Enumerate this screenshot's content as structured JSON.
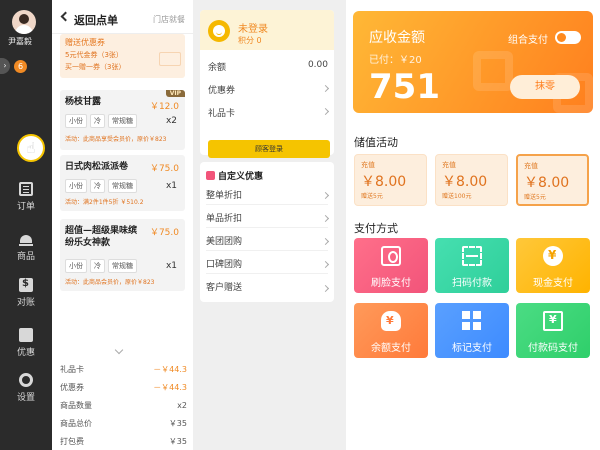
{
  "sidebar": {
    "user_name": "尹嘉毅",
    "badge_count": "6",
    "expand_glyph": "›",
    "active_icon": "hand-pointer-icon",
    "items": [
      {
        "label": "订单",
        "icon": "order-list-icon"
      },
      {
        "label": "商品",
        "icon": "goods-icon"
      },
      {
        "label": "对账",
        "icon": "bill-icon"
      },
      {
        "label": "优惠",
        "icon": "promotion-icon"
      },
      {
        "label": "设置",
        "icon": "settings-icon"
      }
    ]
  },
  "orders": {
    "back_label": "返回点单",
    "store_label": "门店就餐",
    "coupon": {
      "title": "赠送优惠券",
      "line1": "5元代金券（3张）",
      "line2": "买一赠一券（3张）"
    },
    "items": [
      {
        "name": "杨枝甘露",
        "price": "￥12.0",
        "tags": [
          "小份",
          "冷",
          "常规糖"
        ],
        "qty": "x2",
        "note": "活动：此商品享受会员价，原价￥823",
        "vip": "VIP"
      },
      {
        "name": "日式肉松派派卷",
        "price": "￥75.0",
        "tags": [
          "小份",
          "冷",
          "常规糖"
        ],
        "qty": "x1",
        "note": "活动：满2件1件5折 ￥510.2"
      },
      {
        "name": "超值—超级果味缤纷乐女神款",
        "price": "￥75.0",
        "tags": [
          "小份",
          "冷",
          "常规糖"
        ],
        "qty": "x1",
        "note": "活动：此商品会员价，原价￥823"
      }
    ],
    "summary": [
      {
        "label": "礼品卡",
        "value": "－￥44.3",
        "neg": true
      },
      {
        "label": "优惠券",
        "value": "－￥44.3",
        "neg": true
      },
      {
        "label": "商品数量",
        "value": "x2",
        "neg": false
      },
      {
        "label": "商品总价",
        "value": "￥35",
        "neg": false
      },
      {
        "label": "打包费",
        "value": "￥35",
        "neg": false
      }
    ]
  },
  "member": {
    "status": "未登录",
    "points": "积分 0",
    "balance_label": "余额",
    "balance_value": "0.00",
    "coupon_label": "优惠券",
    "gift_card_label": "礼品卡",
    "guest_login": "顾客登录"
  },
  "discounts": {
    "title": "自定义优惠",
    "options": [
      "整单折扣",
      "单品折扣",
      "美团团购",
      "口碑团购",
      "客户赠送"
    ]
  },
  "payment": {
    "due_label": "应收金额",
    "paid_label": "已付：￥20",
    "amount": "751",
    "combo_label": "组合支付",
    "erase_label": "抹零",
    "stored_title": "储值活动",
    "stored_cards": [
      {
        "top": "充值",
        "amount": "￥8.00",
        "bottom": "赠送5元",
        "selected": false
      },
      {
        "top": "充值",
        "amount": "￥8.00",
        "bottom": "赠送100元",
        "selected": false
      },
      {
        "top": "充值",
        "amount": "￥8.00",
        "bottom": "赠送5元",
        "selected": true
      }
    ],
    "methods_title": "支付方式",
    "methods": [
      {
        "label": "刷脸支付",
        "icon": "face-pay-icon",
        "color": "#f2547a"
      },
      {
        "label": "扫码付款",
        "icon": "scan-pay-icon",
        "color": "#2fcf9a"
      },
      {
        "label": "现金支付",
        "icon": "cash-pay-icon",
        "color": "#ffb300"
      },
      {
        "label": "余额支付",
        "icon": "balance-pay-icon",
        "color": "#ff7a3a"
      },
      {
        "label": "标记支付",
        "icon": "mark-pay-icon",
        "color": "#3d8bff"
      },
      {
        "label": "付款码支付",
        "icon": "paycode-pay-icon",
        "color": "#2fcf6a"
      }
    ]
  }
}
